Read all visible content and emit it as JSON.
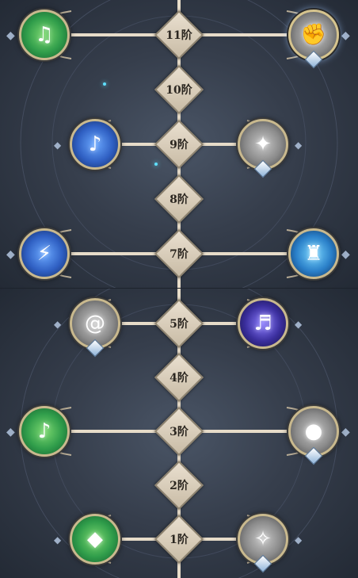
{
  "tiers": {
    "t11": "11阶",
    "t10": "10阶",
    "t9": "9阶",
    "t8": "8阶",
    "t7": "7阶",
    "t5": "5阶",
    "t4": "4阶",
    "t3": "3阶",
    "t2": "2阶",
    "t1": "1阶"
  },
  "skills": [
    {
      "tier": "11阶",
      "side": "left",
      "icon": "music-notes-icon",
      "color": "green",
      "locked": false
    },
    {
      "tier": "11阶",
      "side": "right",
      "icon": "fist-icon",
      "color": "grey",
      "locked": true
    },
    {
      "tier": "9阶",
      "side": "left",
      "icon": "dancer-icon",
      "color": "blue",
      "locked": false
    },
    {
      "tier": "9阶",
      "side": "right",
      "icon": "figure-sparkle-icon",
      "color": "grey",
      "locked": true
    },
    {
      "tier": "7阶",
      "side": "left",
      "icon": "stage-icon",
      "color": "blue",
      "locked": false
    },
    {
      "tier": "7阶",
      "side": "right",
      "icon": "microphone-stand-icon",
      "color": "blue",
      "locked": false
    },
    {
      "tier": "5阶",
      "side": "left",
      "icon": "vortex-icon",
      "color": "grey",
      "locked": true
    },
    {
      "tier": "5阶",
      "side": "right",
      "icon": "record-notes-icon",
      "color": "purple",
      "locked": false
    },
    {
      "tier": "3阶",
      "side": "left",
      "icon": "music-note-icon",
      "color": "green",
      "locked": false
    },
    {
      "tier": "3阶",
      "side": "right",
      "icon": "droplet-icon",
      "color": "grey",
      "locked": true
    },
    {
      "tier": "1阶",
      "side": "left",
      "icon": "crystal-icon",
      "color": "green",
      "locked": false
    },
    {
      "tier": "1阶",
      "side": "right",
      "icon": "wing-icon",
      "color": "grey",
      "locked": true
    }
  ],
  "colors": {
    "background": "#2c3340",
    "node_fill": "#e3d8c5",
    "line": "#e7dcc9",
    "accent_blue": "#5fe0ff"
  }
}
